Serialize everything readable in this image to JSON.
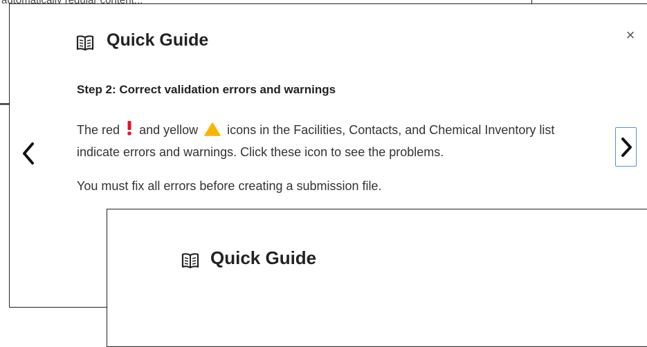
{
  "background": {
    "text": "automatically regular content..."
  },
  "modal": {
    "title": "Quick Guide",
    "close_label": "×",
    "step_title": "Step 2: Correct validation errors and warnings",
    "para1": {
      "part1": "The red",
      "part2": "and yellow",
      "part3": "icons in the Facilities, Contacts, and Chemical Inventory list indicate errors and warnings. Click these icon to see the problems."
    },
    "para2": "You must fix all errors before creating a submission file.",
    "icons": {
      "header": "book-icon",
      "error": "exclamation-icon",
      "warning": "warning-triangle-icon",
      "prev": "chevron-left-icon",
      "next": "chevron-right-icon"
    },
    "colors": {
      "error": "#e81123",
      "warning": "#f7b500",
      "focus": "#5a8fd8"
    }
  },
  "inner_modal": {
    "title": "Quick Guide"
  }
}
